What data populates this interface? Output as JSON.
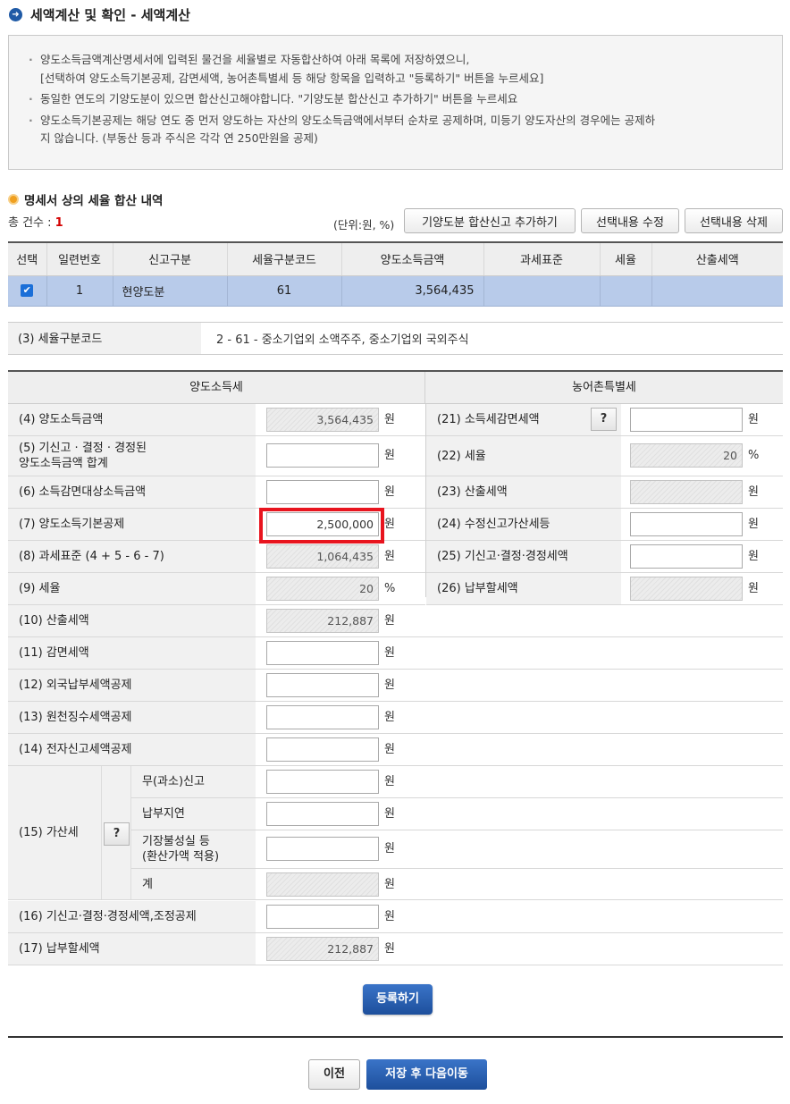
{
  "title": "세액계산 및 확인 - 세액계산",
  "notice": [
    "양도소득금액계산명세서에 입력된 물건을 세율별로 자동합산하여 아래 목록에 저장하였으니,",
    "[선택하여 양도소득기본공제, 감면세액, 농어촌특별세 등 해당 항목을 입력하고 \"등록하기\" 버튼을 누르세요]",
    "동일한 연도의 기양도분이 있으면 합산신고해야합니다. \"기양도분 합산신고 추가하기\" 버튼을 누르세요",
    "양도소득기본공제는 해당 연도 중 먼저 양도하는 자산의 양도소득금액에서부터 순차로 공제하며, 미등기 양도자산의 경우에는 공제하",
    "지 않습니다. (부동산 등과 주식은 각각 연 250만원을 공제)"
  ],
  "section_title": "명세서 상의 세율 합산 내역",
  "total_label": "총 건수 : ",
  "total_count": "1",
  "unit_note": "(단위:원, %)",
  "buttons": {
    "add_prior": "기양도분 합산신고 추가하기",
    "edit": "선택내용 수정",
    "delete": "선택내용 삭제",
    "register": "등록하기",
    "prev": "이전",
    "save_next": "저장 후 다음이동"
  },
  "list": {
    "headers": [
      "선택",
      "일련번호",
      "신고구분",
      "세율구분코드",
      "양도소득금액",
      "과세표준",
      "세율",
      "산출세액"
    ],
    "rows": [
      {
        "checked": true,
        "seq": "1",
        "type": "현양도분",
        "code": "61",
        "income": "3,564,435",
        "base": "",
        "rate": "",
        "tax": ""
      }
    ]
  },
  "rate_code": {
    "label": "(3) 세율구분코드",
    "value": "2  -  61  -  중소기업외 소액주주, 중소기업외 국외주식"
  },
  "headers": {
    "left": "양도소득세",
    "right": "농어촌특별세"
  },
  "q": "?",
  "units": {
    "won": "원",
    "pct": "%"
  },
  "left": {
    "r4": {
      "label": "(4) 양도소득금액",
      "value": "3,564,435"
    },
    "r5": {
      "label1": "(5) 기신고 · 결정 · 경정된",
      "label2": "양도소득금액 합계",
      "value": ""
    },
    "r6": {
      "label": "(6) 소득감면대상소득금액",
      "value": ""
    },
    "r7": {
      "label": "(7) 양도소득기본공제",
      "value": "2,500,000"
    },
    "r8": {
      "label": "(8) 과세표준 (4 + 5 - 6 - 7)",
      "value": "1,064,435"
    },
    "r9": {
      "label": "(9) 세율",
      "value": "20"
    },
    "r10": {
      "label": "(10) 산출세액",
      "value": "212,887"
    },
    "r11": {
      "label": "(11) 감면세액",
      "value": ""
    },
    "r12": {
      "label": "(12) 외국납부세액공제",
      "value": ""
    },
    "r13": {
      "label": "(13) 원천징수세액공제",
      "value": ""
    },
    "r14": {
      "label": "(14) 전자신고세액공제",
      "value": ""
    },
    "r15": {
      "label": "(15) 가산세",
      "sub1": {
        "label": "무(과소)신고",
        "value": ""
      },
      "sub2": {
        "label": "납부지연",
        "value": ""
      },
      "sub3": {
        "label1": "기장불성실 등",
        "label2": "(환산가액 적용)",
        "value": ""
      },
      "sub4": {
        "label": "계",
        "value": ""
      }
    },
    "r16": {
      "label": "(16) 기신고·결정·경정세액,조정공제",
      "value": ""
    },
    "r17": {
      "label": "(17) 납부할세액",
      "value": "212,887"
    }
  },
  "right": {
    "r21": {
      "label": "(21) 소득세감면세액",
      "value": ""
    },
    "r22": {
      "label": "(22) 세율",
      "value": "20"
    },
    "r23": {
      "label": "(23) 산출세액",
      "value": ""
    },
    "r24": {
      "label": "(24) 수정신고가산세등",
      "value": ""
    },
    "r25": {
      "label": "(25) 기신고·결정·경정세액",
      "value": ""
    },
    "r26": {
      "label": "(26) 납부할세액",
      "value": ""
    }
  }
}
